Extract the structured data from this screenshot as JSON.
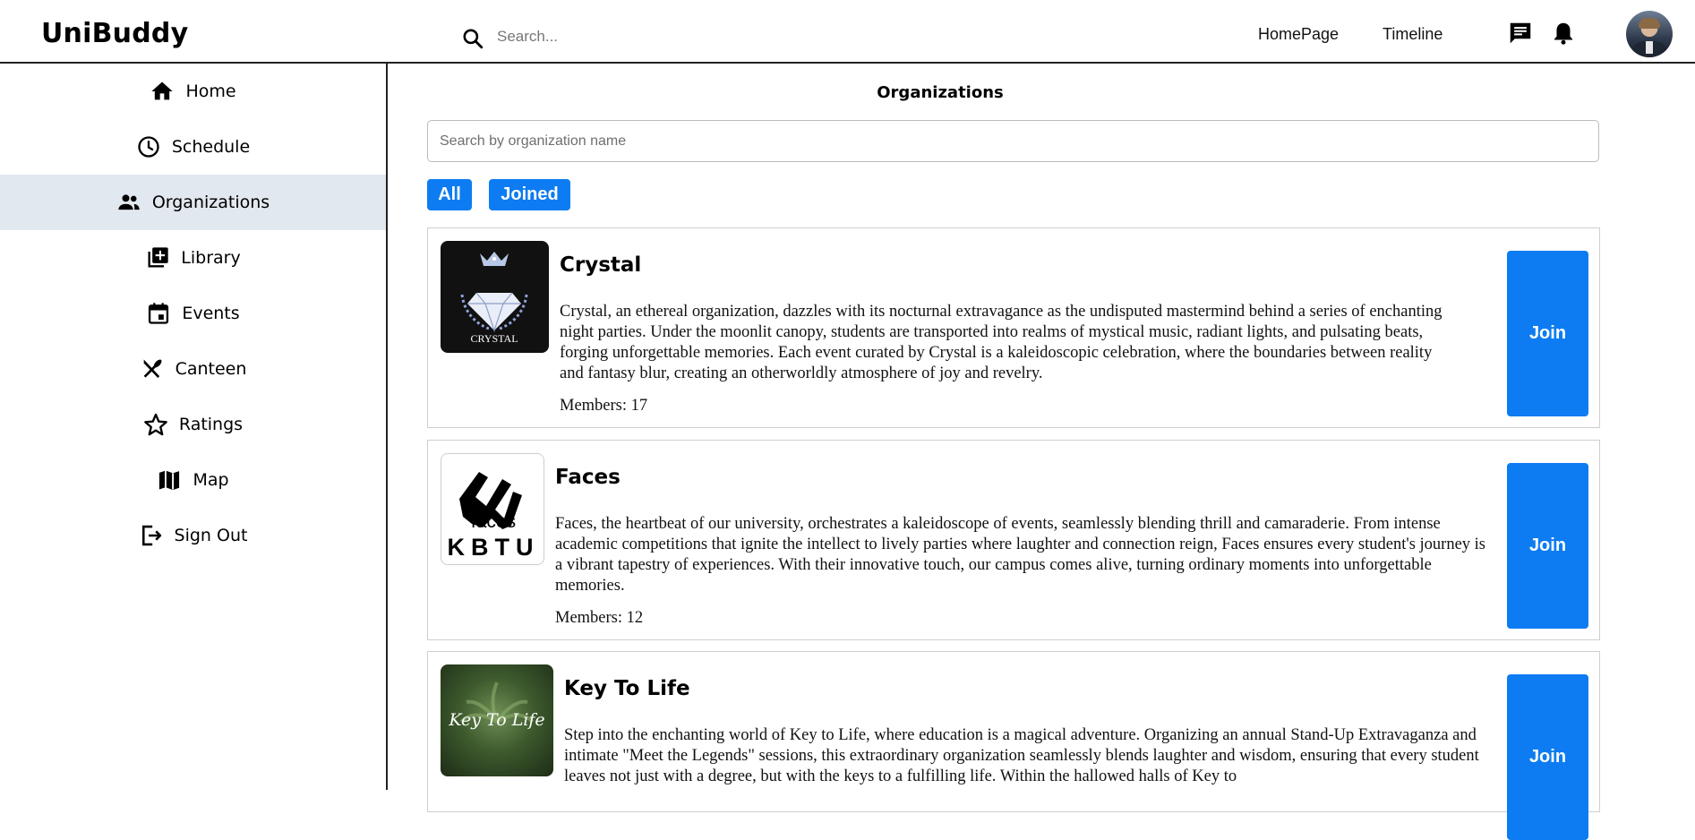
{
  "header": {
    "logo": "UniBuddy",
    "search_placeholder": "Search...",
    "nav": {
      "home": "HomePage",
      "timeline": "Timeline"
    }
  },
  "sidebar": {
    "items": [
      {
        "label": "Home",
        "icon": "home-icon"
      },
      {
        "label": "Schedule",
        "icon": "clock-icon"
      },
      {
        "label": "Organizations",
        "icon": "people-icon",
        "active": true
      },
      {
        "label": "Library",
        "icon": "library-add-icon"
      },
      {
        "label": "Events",
        "icon": "calendar-icon"
      },
      {
        "label": "Canteen",
        "icon": "utensils-icon"
      },
      {
        "label": "Ratings",
        "icon": "star-icon"
      },
      {
        "label": "Map",
        "icon": "map-icon"
      },
      {
        "label": "Sign Out",
        "icon": "sign-out-icon"
      }
    ]
  },
  "main": {
    "title": "Organizations",
    "search_placeholder": "Search by organization name",
    "filters": {
      "all": "All",
      "joined": "Joined"
    },
    "join_label": "Join",
    "organizations": [
      {
        "name": "Crystal",
        "logo_text": "CRYSTAL",
        "description": "Crystal, an ethereal organization, dazzles with its nocturnal extravagance as the undisputed mastermind behind a series of enchanting night parties. Under the moonlit canopy, students are transported into realms of mystical music, radiant lights, and pulsating beats, forging unforgettable memories. Each event curated by Crystal is a kaleidoscopic celebration, where the boundaries between reality and fantasy blur, creating an otherworldly atmosphere of joy and revelry.",
        "members": "Members: 17"
      },
      {
        "name": "Faces",
        "logo_text_top": "faces",
        "logo_text_bottom": "KBTU",
        "description": "Faces, the heartbeat of our university, orchestrates a kaleidoscope of events, seamlessly blending thrill and camaraderie. From intense academic competitions that ignite the intellect to lively parties where laughter and connection reign, Faces ensures every student's journey is a vibrant tapestry of experiences. With their innovative touch, our campus comes alive, turning ordinary moments into unforgettable memories.",
        "members": "Members: 12"
      },
      {
        "name": "Key To Life",
        "logo_text": "Key To Life",
        "description": "Step into the enchanting world of Key to Life, where education is a magical adventure. Organizing an annual Stand-Up Extravaganza and intimate \"Meet the Legends\" sessions, this extraordinary organization seamlessly blends laughter and wisdom, ensuring that every student leaves not just with a degree, but with the keys to a fulfilling life. Within the hallowed halls of Key to"
      }
    ]
  },
  "colors": {
    "accent": "#0d7cf2",
    "sidebar_active": "#e2e8ef"
  }
}
